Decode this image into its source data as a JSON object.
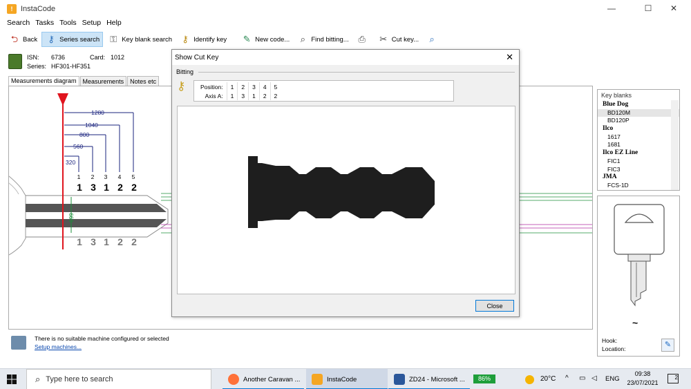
{
  "window": {
    "title": "InstaCode",
    "minimize": "—",
    "maximize": "☐",
    "close": "✕"
  },
  "menu": [
    "Search",
    "Tasks",
    "Tools",
    "Setup",
    "Help"
  ],
  "toolbar": {
    "back": "Back",
    "series_search": "Series search",
    "key_blank_search": "Key blank search",
    "identify_key": "Identify key",
    "new_code": "New code...",
    "find_bitting": "Find bitting...",
    "cut_key": "Cut key..."
  },
  "info": {
    "isn_label": "ISN:",
    "isn_value": "6736",
    "card_label": "Card:",
    "card_value": "1012",
    "series_label": "Series:",
    "series_value": "HF301-HF351"
  },
  "tabs": [
    "Measurements diagram",
    "Measurements",
    "Notes etc"
  ],
  "diagram": {
    "depth_measurements": [
      "1280",
      "1040",
      "800",
      "560",
      "320"
    ],
    "positions": [
      "1",
      "2",
      "3",
      "4",
      "5"
    ],
    "cuts": [
      "1",
      "3",
      "1",
      "2",
      "2"
    ],
    "shoulder_measurement": "660"
  },
  "key_blanks": {
    "header": "Key blanks",
    "rows": [
      {
        "text": "Blue Dog",
        "kind": "bold"
      },
      {
        "text": "BD120M",
        "kind": "leaf",
        "selected": true
      },
      {
        "text": "BD120P",
        "kind": "leaf"
      },
      {
        "text": "Ilco",
        "kind": "bold"
      },
      {
        "text": "1617",
        "kind": "leaf"
      },
      {
        "text": "1681",
        "kind": "leaf"
      },
      {
        "text": "Ilco EZ Line",
        "kind": "bold"
      },
      {
        "text": "FIC1",
        "kind": "leaf"
      },
      {
        "text": "FIC3",
        "kind": "leaf"
      },
      {
        "text": "JMA",
        "kind": "bold"
      },
      {
        "text": "FCS-1D",
        "kind": "leaf"
      }
    ]
  },
  "blank_panel": {
    "hook_label": "Hook:",
    "location_label": "Location:",
    "profile_symbol": "~"
  },
  "status": {
    "message": "There is no suitable machine configured or selected",
    "link": "Setup machines..."
  },
  "dialog": {
    "title": "Show Cut Key",
    "group": "Bitting",
    "position_label": "Position:",
    "axis_label": "Axis A:",
    "positions": [
      "1",
      "2",
      "3",
      "4",
      "5"
    ],
    "axis_values": [
      "1",
      "3",
      "1",
      "2",
      "2"
    ],
    "close_button": "Close"
  },
  "taskbar": {
    "search_placeholder": "Type here to search",
    "apps": [
      "Another Caravan ...",
      "InstaCode",
      "ZD24 - Microsoft ..."
    ],
    "battery": "86%",
    "temperature": "20°C",
    "language": "ENG",
    "time": "09:38",
    "date": "23/07/2021",
    "notifications": "2"
  },
  "colors": {
    "accent": "#0078d7",
    "active_tool": "#cce4f7",
    "cut_key_fill": "#1e1e1e",
    "red_marker": "#e0141e",
    "dim_blue": "#1a237e"
  }
}
